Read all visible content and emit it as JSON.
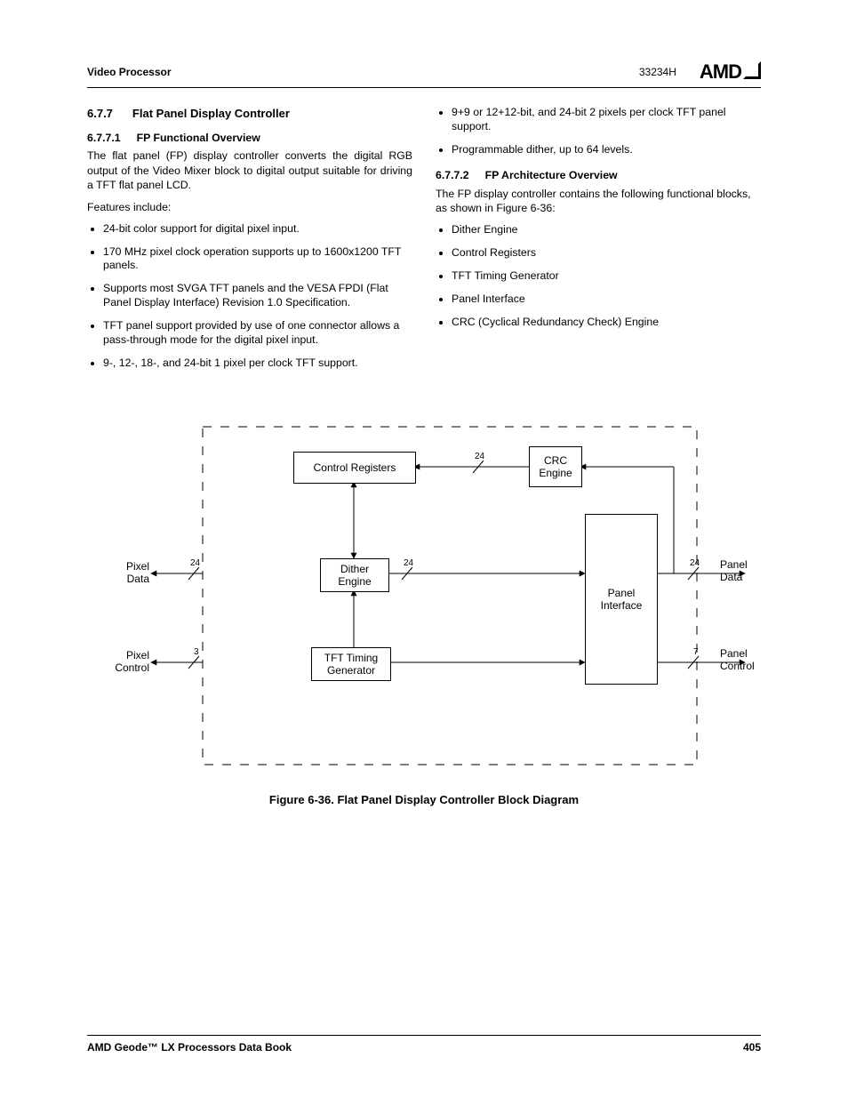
{
  "header": {
    "left": "Video Processor",
    "doc_id": "33234H",
    "logo": "AMD"
  },
  "left_col": {
    "sec_num": "6.7.7",
    "sec_title": "Flat Panel Display Controller",
    "sub1_num": "6.7.7.1",
    "sub1_title": "FP Functional Overview",
    "para1": "The flat panel (FP) display controller converts the digital RGB output of the Video Mixer block to digital output suitable for driving a TFT flat panel LCD.",
    "para2": "Features include:",
    "features": [
      "24-bit color support for digital pixel input.",
      "170 MHz pixel clock operation supports up to 1600x1200 TFT panels.",
      "Supports most SVGA TFT panels and the VESA FPDI (Flat Panel Display Interface) Revision 1.0 Specification.",
      "TFT panel support provided by use of one connector allows a pass-through mode for the digital pixel input.",
      "9-, 12-, 18-, and 24-bit 1 pixel per clock TFT support."
    ]
  },
  "right_col": {
    "features_cont": [
      "9+9 or 12+12-bit, and 24-bit 2 pixels per clock TFT panel support.",
      "Programmable dither, up to 64 levels."
    ],
    "sub2_num": "6.7.7.2",
    "sub2_title": "FP Architecture Overview",
    "para1": "The FP display controller contains the following functional blocks, as shown in Figure 6-36:",
    "blocks": [
      "Dither Engine",
      "Control Registers",
      "TFT Timing Generator",
      "Panel Interface",
      "CRC (Cyclical Redundancy Check) Engine"
    ]
  },
  "diagram": {
    "pixel_data_in": "Pixel\nData",
    "pixel_control_in": "Pixel\nControl",
    "panel_data_out": "Panel\nData",
    "panel_control_out": "Panel\nControl",
    "control_registers": "Control Registers",
    "crc_engine": "CRC\nEngine",
    "dither_engine": "Dither\nEngine",
    "tft_timing": "TFT Timing\nGenerator",
    "panel_interface": "Panel\nInterface",
    "w24a": "24",
    "w24b": "24",
    "w24c": "24",
    "w24d": "24",
    "w3": "3",
    "w7": "7"
  },
  "caption": "Figure 6-36.  Flat Panel Display Controller Block Diagram",
  "footer": {
    "left": "AMD Geode™ LX Processors Data Book",
    "right": "405"
  }
}
